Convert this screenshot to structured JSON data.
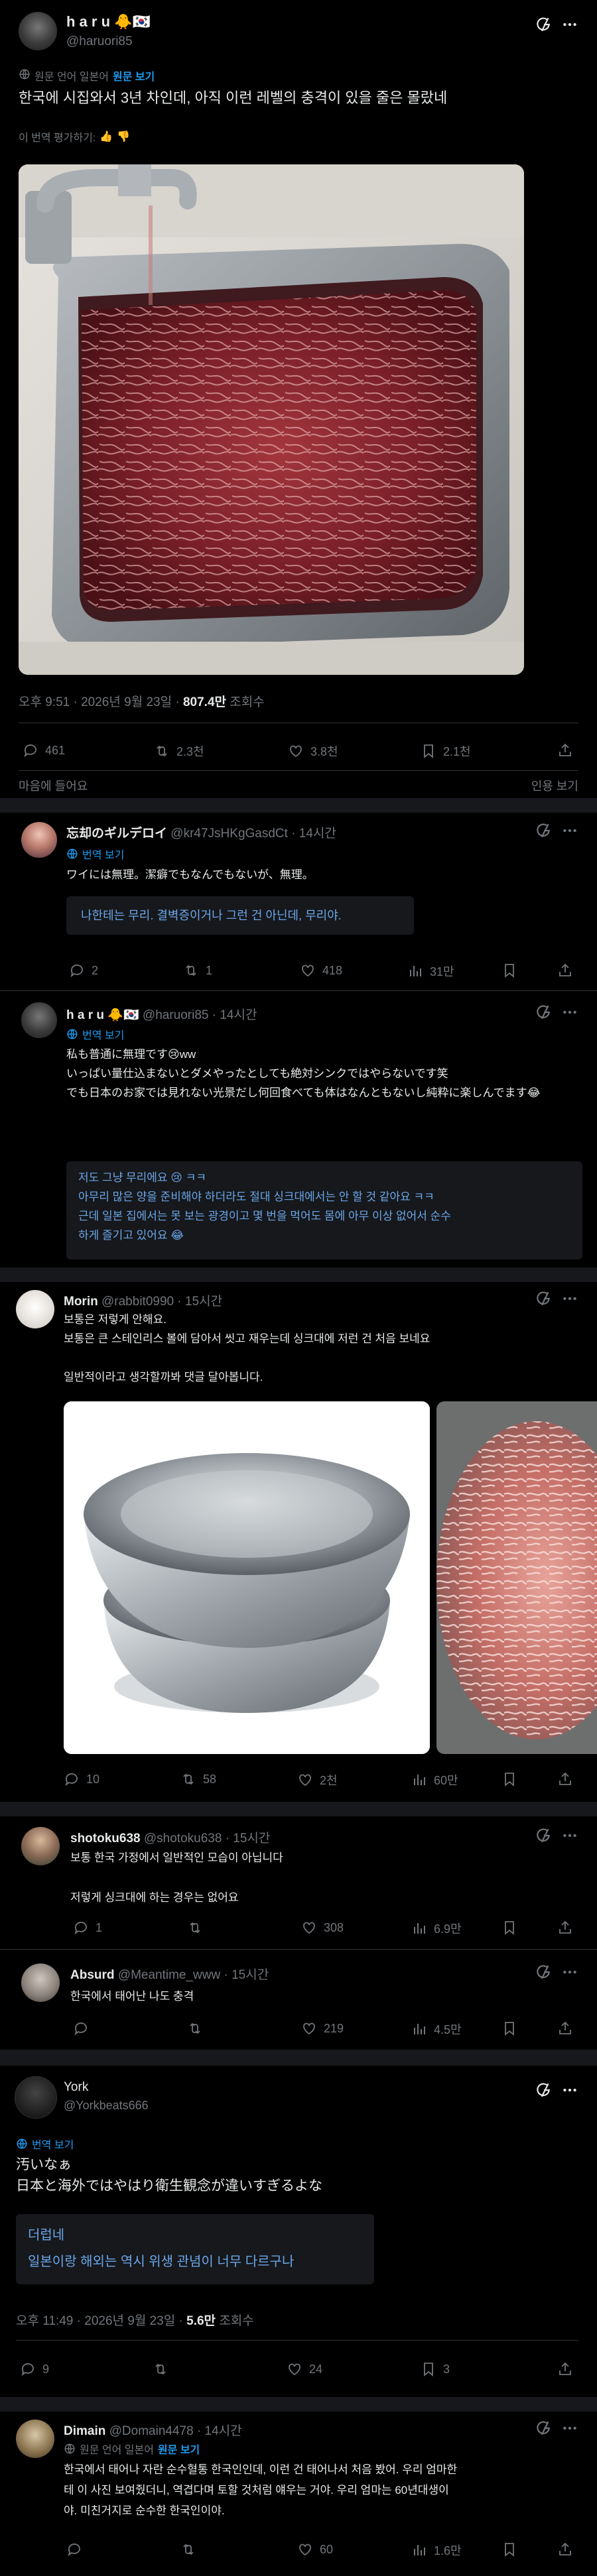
{
  "main_post": {
    "display_name": "h a r u",
    "handle": "@haruori85",
    "translated_note": "원문 언어 일본어",
    "show_original": "원문 보기",
    "text": "한국에 시집와서 3년 차인데, 아직 이런 레벨의 충격이 있을 줄은 몰랐네",
    "rate_translation": "이 번역 평가하기:",
    "time": "오후 9:51 · 2026년 9월 23일 ·",
    "views": "807.4만",
    "views_label": "조회수",
    "replies": "461",
    "retweets": "2.3천",
    "likes": "3.8천",
    "bookmarks": "2.1천",
    "like_prompt": "마음에 들어요",
    "quote_label": "인용 보기"
  },
  "reply1": {
    "display_name": "忘却のギルデロイ",
    "handle": "@kr47JsHKgGasdCt · 14시간",
    "view_translation": "번역 보기",
    "text": "ワイには無理。潔癖でもなんでもないが、無理。",
    "translation": "나한테는 무리. 결벽증이거나 그런 건 아닌데, 무리야.",
    "replies": "2",
    "retweets": "1",
    "likes": "418",
    "views": "31만"
  },
  "reply2": {
    "display_name": "h a r u",
    "handle": "@haruori85 · 14시간",
    "view_translation": "번역 보기",
    "text_lines": [
      "私も普通に無理です😢ww",
      "いっぱい量仕込まないとダメやったとしても絶対シンクではやらないです笑",
      "でも日本のお家では見れない光景だし何回食べても体はなんともないし純粋に楽しんでます😂"
    ],
    "translation_lines": [
      "저도 그냥 무리에요 😢 ㅋㅋ",
      "아무리 많은 양을 준비해야 하더라도 절대 싱크대에서는 안 할 것 같아요 ㅋㅋ",
      "근데 일본 집에서는 못 보는 광경이고 몇 번을 먹어도 몸에 아무 이상 없어서 순수",
      "하게 즐기고 있어요 😂"
    ]
  },
  "reply3": {
    "display_name": "Morin",
    "handle": "@rabbit0990 · 15시간",
    "text_lines": [
      "보통은 저렇게 안해요.",
      "보통은 큰 스테인리스 볼에 담아서 씻고 재우는데 싱크대에 저런 건 처음 보네요",
      "",
      "일반적이라고 생각할까봐 댓글 달아봅니다."
    ],
    "replies": "10",
    "retweets": "58",
    "likes": "2천",
    "views": "60만"
  },
  "reply4": {
    "display_name": "shotoku638",
    "handle": "@shotoku638 · 15시간",
    "text_lines": [
      "보통 한국 가정에서 일반적인 모습이 아닙니다",
      "",
      "저렇게 싱크대에 하는 경우는 없어요"
    ],
    "replies": "1",
    "retweets": "",
    "likes": "308",
    "views": "6.9만"
  },
  "reply5": {
    "display_name": "Absurd",
    "handle": "@Meantime_www · 15시간",
    "text": "한국에서 태어난 나도 충격",
    "replies": "",
    "retweets": "",
    "likes": "219",
    "views": "4.5만"
  },
  "quote_post": {
    "display_name": "York",
    "handle": "@Yorkbeats666",
    "view_translation": "번역 보기",
    "text_lines": [
      "汚いなぁ",
      "日本と海外ではやはり衛生観念が違いすぎるよな"
    ],
    "translation_lines": [
      "더럽네",
      "일본이랑 해외는 역시 위생 관념이 너무 다르구나"
    ],
    "time": "오후 11:49 · 2026년 9월 23일 ·",
    "views": "5.6만",
    "views_label": "조회수",
    "replies": "9",
    "retweets": "",
    "likes": "24",
    "bookmarks": "3"
  },
  "reply6": {
    "display_name": "Dimain",
    "handle": "@Domain4478 · 14시간",
    "translated_note": "원문 언어 일본어",
    "show_original": "원문 보기",
    "text_lines": [
      "한국에서 태어나 자란 순수혈통 한국인인데, 이런 건 태어나서 처음 봤어. 우리 엄마한",
      "테 이 사진 보여줬더니, 역겹다며 토할 것처럼 얘우는 거야. 우리 엄마는 60년대생이",
      "야. 미친거지로 순수한 한국인이야."
    ],
    "replies": "",
    "retweets": "",
    "likes": "60",
    "views": "1.6만"
  },
  "colors": {
    "background": "#000000",
    "text": "#e7e9ea",
    "muted": "#71767b",
    "link": "#1d9bf0",
    "translation_box": "#16181c"
  }
}
